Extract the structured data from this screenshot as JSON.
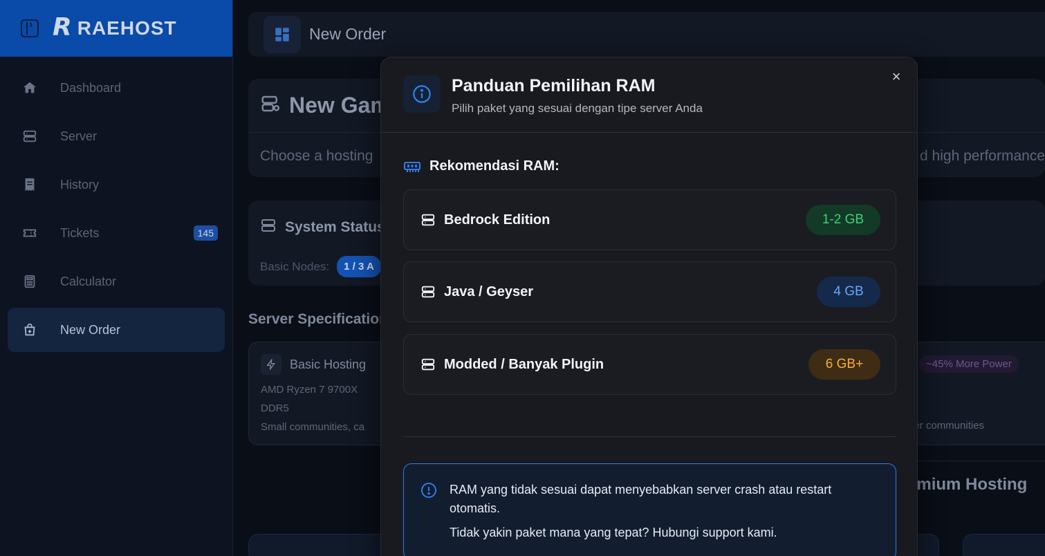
{
  "brand": {
    "name": "RAEHOST",
    "logo_letter": "R"
  },
  "sidebar": {
    "items": [
      {
        "label": "Dashboard",
        "icon": "home-icon"
      },
      {
        "label": "Server",
        "icon": "server-icon"
      },
      {
        "label": "History",
        "icon": "receipt-icon"
      },
      {
        "label": "Tickets",
        "icon": "ticket-icon",
        "badge": "145"
      },
      {
        "label": "Calculator",
        "icon": "calculator-icon"
      },
      {
        "label": "New Order",
        "icon": "shopping-bag-icon",
        "active": true
      }
    ]
  },
  "header": {
    "title": "New Order"
  },
  "main": {
    "page_title": "New Gam",
    "subtitle_left": "Choose a hosting",
    "subtitle_right": "d high performance",
    "system_status": {
      "title": "System Status",
      "nodes_label": "Basic Nodes:",
      "nodes_value": "1 / 3 A"
    },
    "specs_title": "Server Specification",
    "basic_card": {
      "title": "Basic Hosting",
      "cpu": "AMD Ryzen 7 9700X",
      "ram_type": "DDR5",
      "audience": "Small communities, ca"
    },
    "premium_card": {
      "badge": "~45% More Power",
      "audience": "ger communities"
    },
    "premium_title": "emium Hosting"
  },
  "modal": {
    "title": "Panduan Pemilihan RAM",
    "subtitle": "Pilih paket yang sesuai dengan tipe server Anda",
    "section_title": "Rekomendasi RAM:",
    "rows": [
      {
        "label": "Bedrock Edition",
        "value": "1-2 GB"
      },
      {
        "label": "Java / Geyser",
        "value": "4 GB"
      },
      {
        "label": "Modded / Banyak Plugin",
        "value": "6 GB+"
      }
    ],
    "warning": "RAM yang tidak sesuai dapat menyebabkan server crash atau restart otomatis.",
    "help": "Tidak yakin paket mana yang tepat? Hubungi support kami.",
    "close_glyph": "×"
  },
  "colors": {
    "accent": "#2f7de8",
    "brand": "#0a4aa8",
    "green": "#3ed07c",
    "blue": "#6aa6ff",
    "orange": "#f5b03b"
  }
}
